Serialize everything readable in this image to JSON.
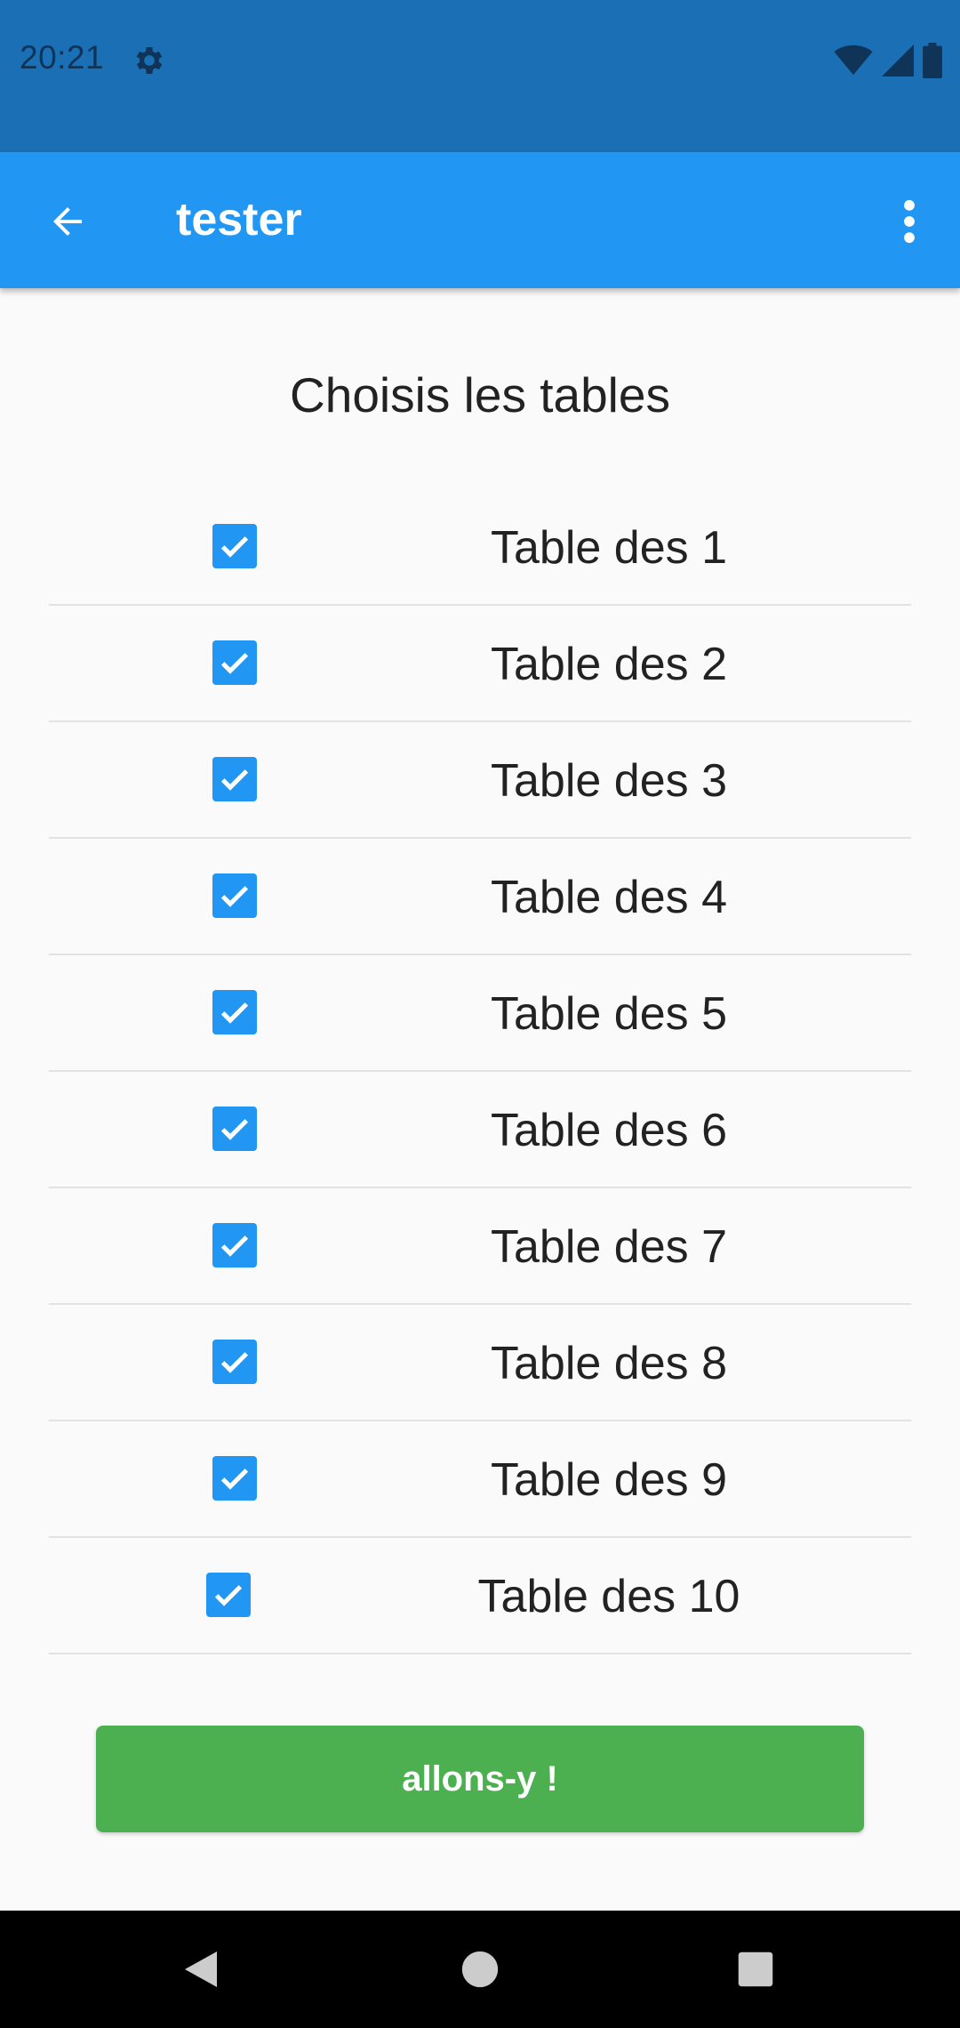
{
  "status_bar": {
    "time": "20:21",
    "color": "#1b6fb5",
    "icons": [
      "settings-gear-icon",
      "wifi-icon",
      "signal-icon",
      "battery-icon"
    ]
  },
  "app_bar": {
    "title": "tester",
    "color": "#2196f3",
    "back_icon": "arrow-back-icon",
    "menu_icon": "more-vert-icon"
  },
  "heading": "Choisis les tables",
  "tables": [
    {
      "label": "Table des 1",
      "checked": true
    },
    {
      "label": "Table des 2",
      "checked": true
    },
    {
      "label": "Table des 3",
      "checked": true
    },
    {
      "label": "Table des 4",
      "checked": true
    },
    {
      "label": "Table des 5",
      "checked": true
    },
    {
      "label": "Table des 6",
      "checked": true
    },
    {
      "label": "Table des 7",
      "checked": true
    },
    {
      "label": "Table des 8",
      "checked": true
    },
    {
      "label": "Table des 9",
      "checked": true
    },
    {
      "label": "Table des 10",
      "checked": true
    }
  ],
  "go_button": {
    "label": "allons-y !",
    "color": "#4caf50"
  },
  "nav_bar": {
    "buttons": [
      "back-triangle-icon",
      "home-circle-icon",
      "recents-square-icon"
    ]
  }
}
